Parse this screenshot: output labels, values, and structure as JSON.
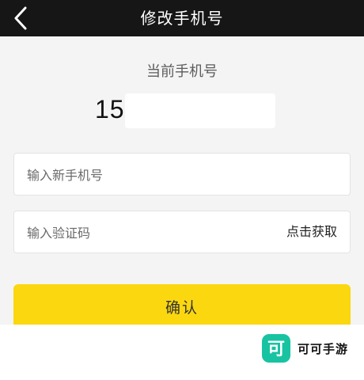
{
  "header": {
    "title": "修改手机号",
    "back_icon": "chevron-left-icon"
  },
  "current": {
    "label": "当前手机号",
    "number_visible": "15"
  },
  "inputs": {
    "new_phone_placeholder": "输入新手机号",
    "verify_placeholder": "输入验证码",
    "get_code_label": "点击获取"
  },
  "confirm_label": "确认",
  "watermark": {
    "logo_char": "可",
    "text": "可可手游"
  },
  "colors": {
    "header_bg": "#161616",
    "confirm_bg": "#fbd70f",
    "watermark_logo_bg": "#18c3a2"
  }
}
